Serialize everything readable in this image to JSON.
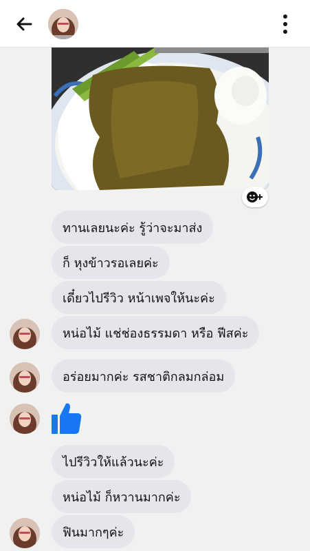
{
  "header": {
    "back_icon": "arrow-left-icon",
    "more_icon": "three-dots-vertical-icon"
  },
  "photo": {
    "reaction_icon": "smiley-plus-icon"
  },
  "messages": [
    {
      "text": "ทานเลยนะค่ะ รู้ว่าจะมาส่ง"
    },
    {
      "text": "ก็ หุงข้าวรอเลยค่ะ"
    },
    {
      "text": "เดี๋ยวไปรีวิว หน้าเพจให้นะค่ะ"
    },
    {
      "text": "หน่อไม้ แช่ช่องธรรมดา หรือ ฟีสค่ะ"
    },
    {
      "text": "อร่อยมากค่ะ รสชาติกลมกล่อม"
    },
    {
      "text": "ไปรีวิวให้แล้วนะค่ะ"
    },
    {
      "text": "หน่อไม้ ก็หวานมากค่ะ"
    },
    {
      "text": "ฟินมากๆค่ะ"
    }
  ],
  "like": {
    "icon": "thumbs-up-icon",
    "color": "#1877f2"
  },
  "colors": {
    "bubble": "#e4e6eb",
    "background": "#f1f1f2"
  }
}
